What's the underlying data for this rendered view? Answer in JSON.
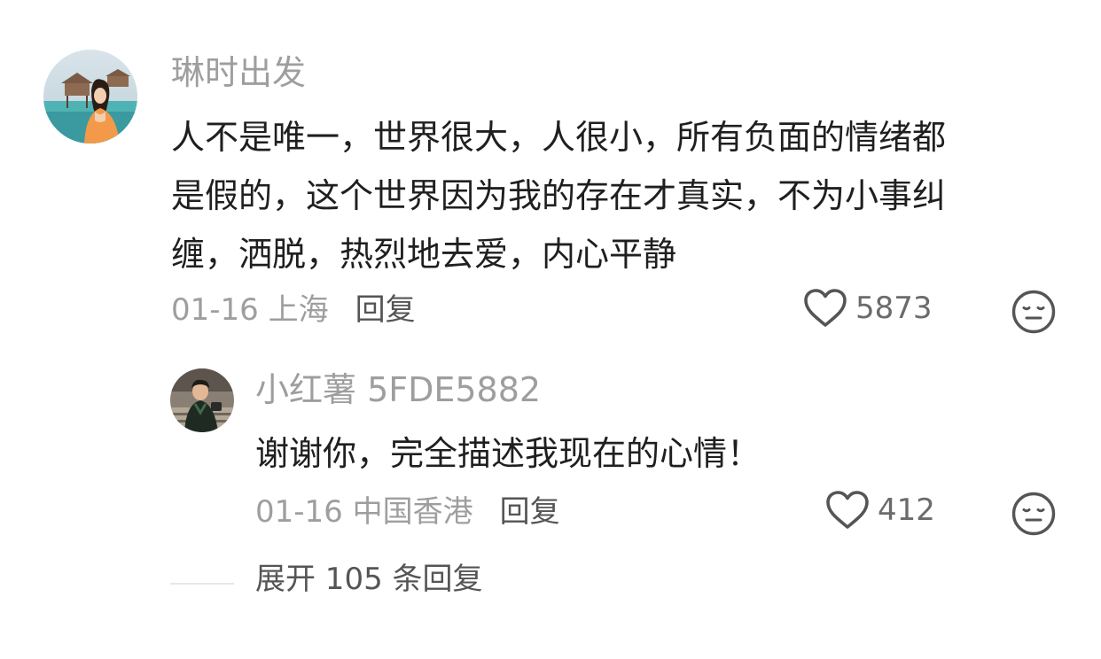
{
  "comment": {
    "username": "琳时出发",
    "text_lines": [
      "人不是唯一，世界很大，人很小，所有负面的情绪都",
      "是假的，这个世界因为我的存在才真实，不为小事纠",
      "缠，洒脱，热烈地去爱，内心平静"
    ],
    "date_location": "01-16 上海",
    "reply_label": "回复",
    "likes": "5873",
    "icons": {
      "like": "heart-outline-icon",
      "dislike": "neutral-face-icon"
    }
  },
  "reply": {
    "username": "小红薯 5FDE5882",
    "text": "谢谢你，完全描述我现在的心情！",
    "date_location": "01-16 中国香港",
    "reply_label": "回复",
    "likes": "412",
    "icons": {
      "like": "heart-outline-icon",
      "dislike": "neutral-face-icon"
    }
  },
  "expand": {
    "label": "展开 105 条回复"
  },
  "colors": {
    "username": "#9e9e9e",
    "body_text": "#1f1f1f",
    "meta_text": "#9e9e9e",
    "action_text": "#555555",
    "icon_stroke": "#555555"
  }
}
